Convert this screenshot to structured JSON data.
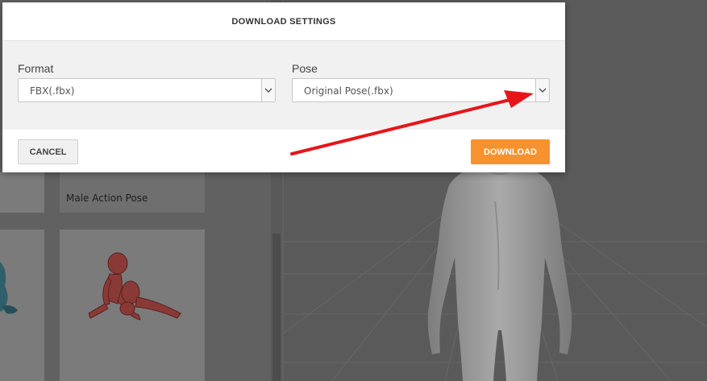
{
  "modal": {
    "title": "DOWNLOAD SETTINGS",
    "format": {
      "label": "Format",
      "value": "FBX(.fbx)"
    },
    "pose": {
      "label": "Pose",
      "value": "Original Pose(.fbx)"
    },
    "cancel_label": "CANCEL",
    "download_label": "DOWNLOAD"
  },
  "background": {
    "card_title": "Male Action Pose"
  },
  "colors": {
    "accent": "#f7922e",
    "annotation_arrow": "#e8141a"
  }
}
